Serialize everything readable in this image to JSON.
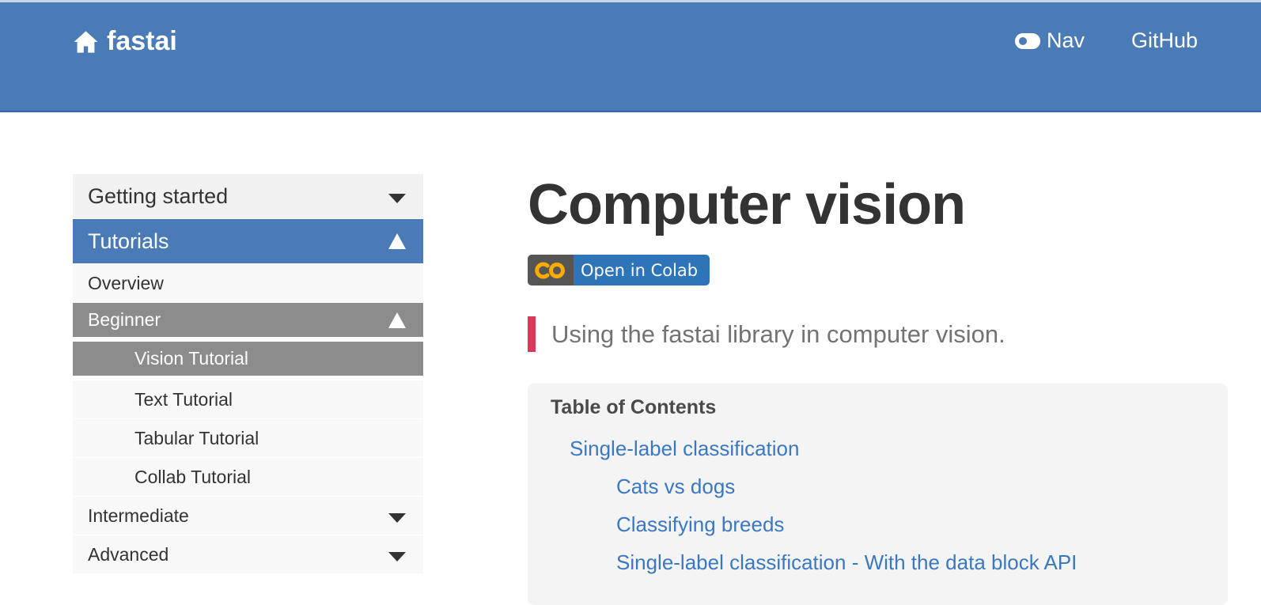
{
  "header": {
    "brand": "fastai",
    "nav_label": "Nav",
    "github_label": "GitHub"
  },
  "sidebar": {
    "items": [
      {
        "label": "Getting started",
        "state": "collapsed"
      },
      {
        "label": "Tutorials",
        "state": "expanded",
        "active": true
      },
      {
        "label": "Overview"
      },
      {
        "label": "Beginner",
        "state": "expanded"
      },
      {
        "label": "Vision Tutorial",
        "selected": true
      },
      {
        "label": "Text Tutorial"
      },
      {
        "label": "Tabular Tutorial"
      },
      {
        "label": "Collab Tutorial"
      },
      {
        "label": "Intermediate",
        "state": "collapsed"
      },
      {
        "label": "Advanced",
        "state": "collapsed"
      }
    ]
  },
  "main": {
    "title": "Computer vision",
    "badge": {
      "logo_text": "CO",
      "label": "Open in Colab"
    },
    "summary": "Using the fastai library in computer vision.",
    "toc": {
      "title": "Table of Contents",
      "links": [
        "Single-label classification",
        "Cats vs dogs",
        "Classifying breeds",
        "Single-label classification - With the data block API"
      ]
    }
  },
  "colors": {
    "header_bg": "#4a7bb7",
    "active_item_bg": "#4a7bb7",
    "selected_item_bg": "#8c8c8c",
    "link": "#3a78c2",
    "quote_bar": "#dc3a5a",
    "badge_right": "#2e74b8",
    "badge_left": "#555555",
    "colab_logo": "#f9ab00"
  }
}
